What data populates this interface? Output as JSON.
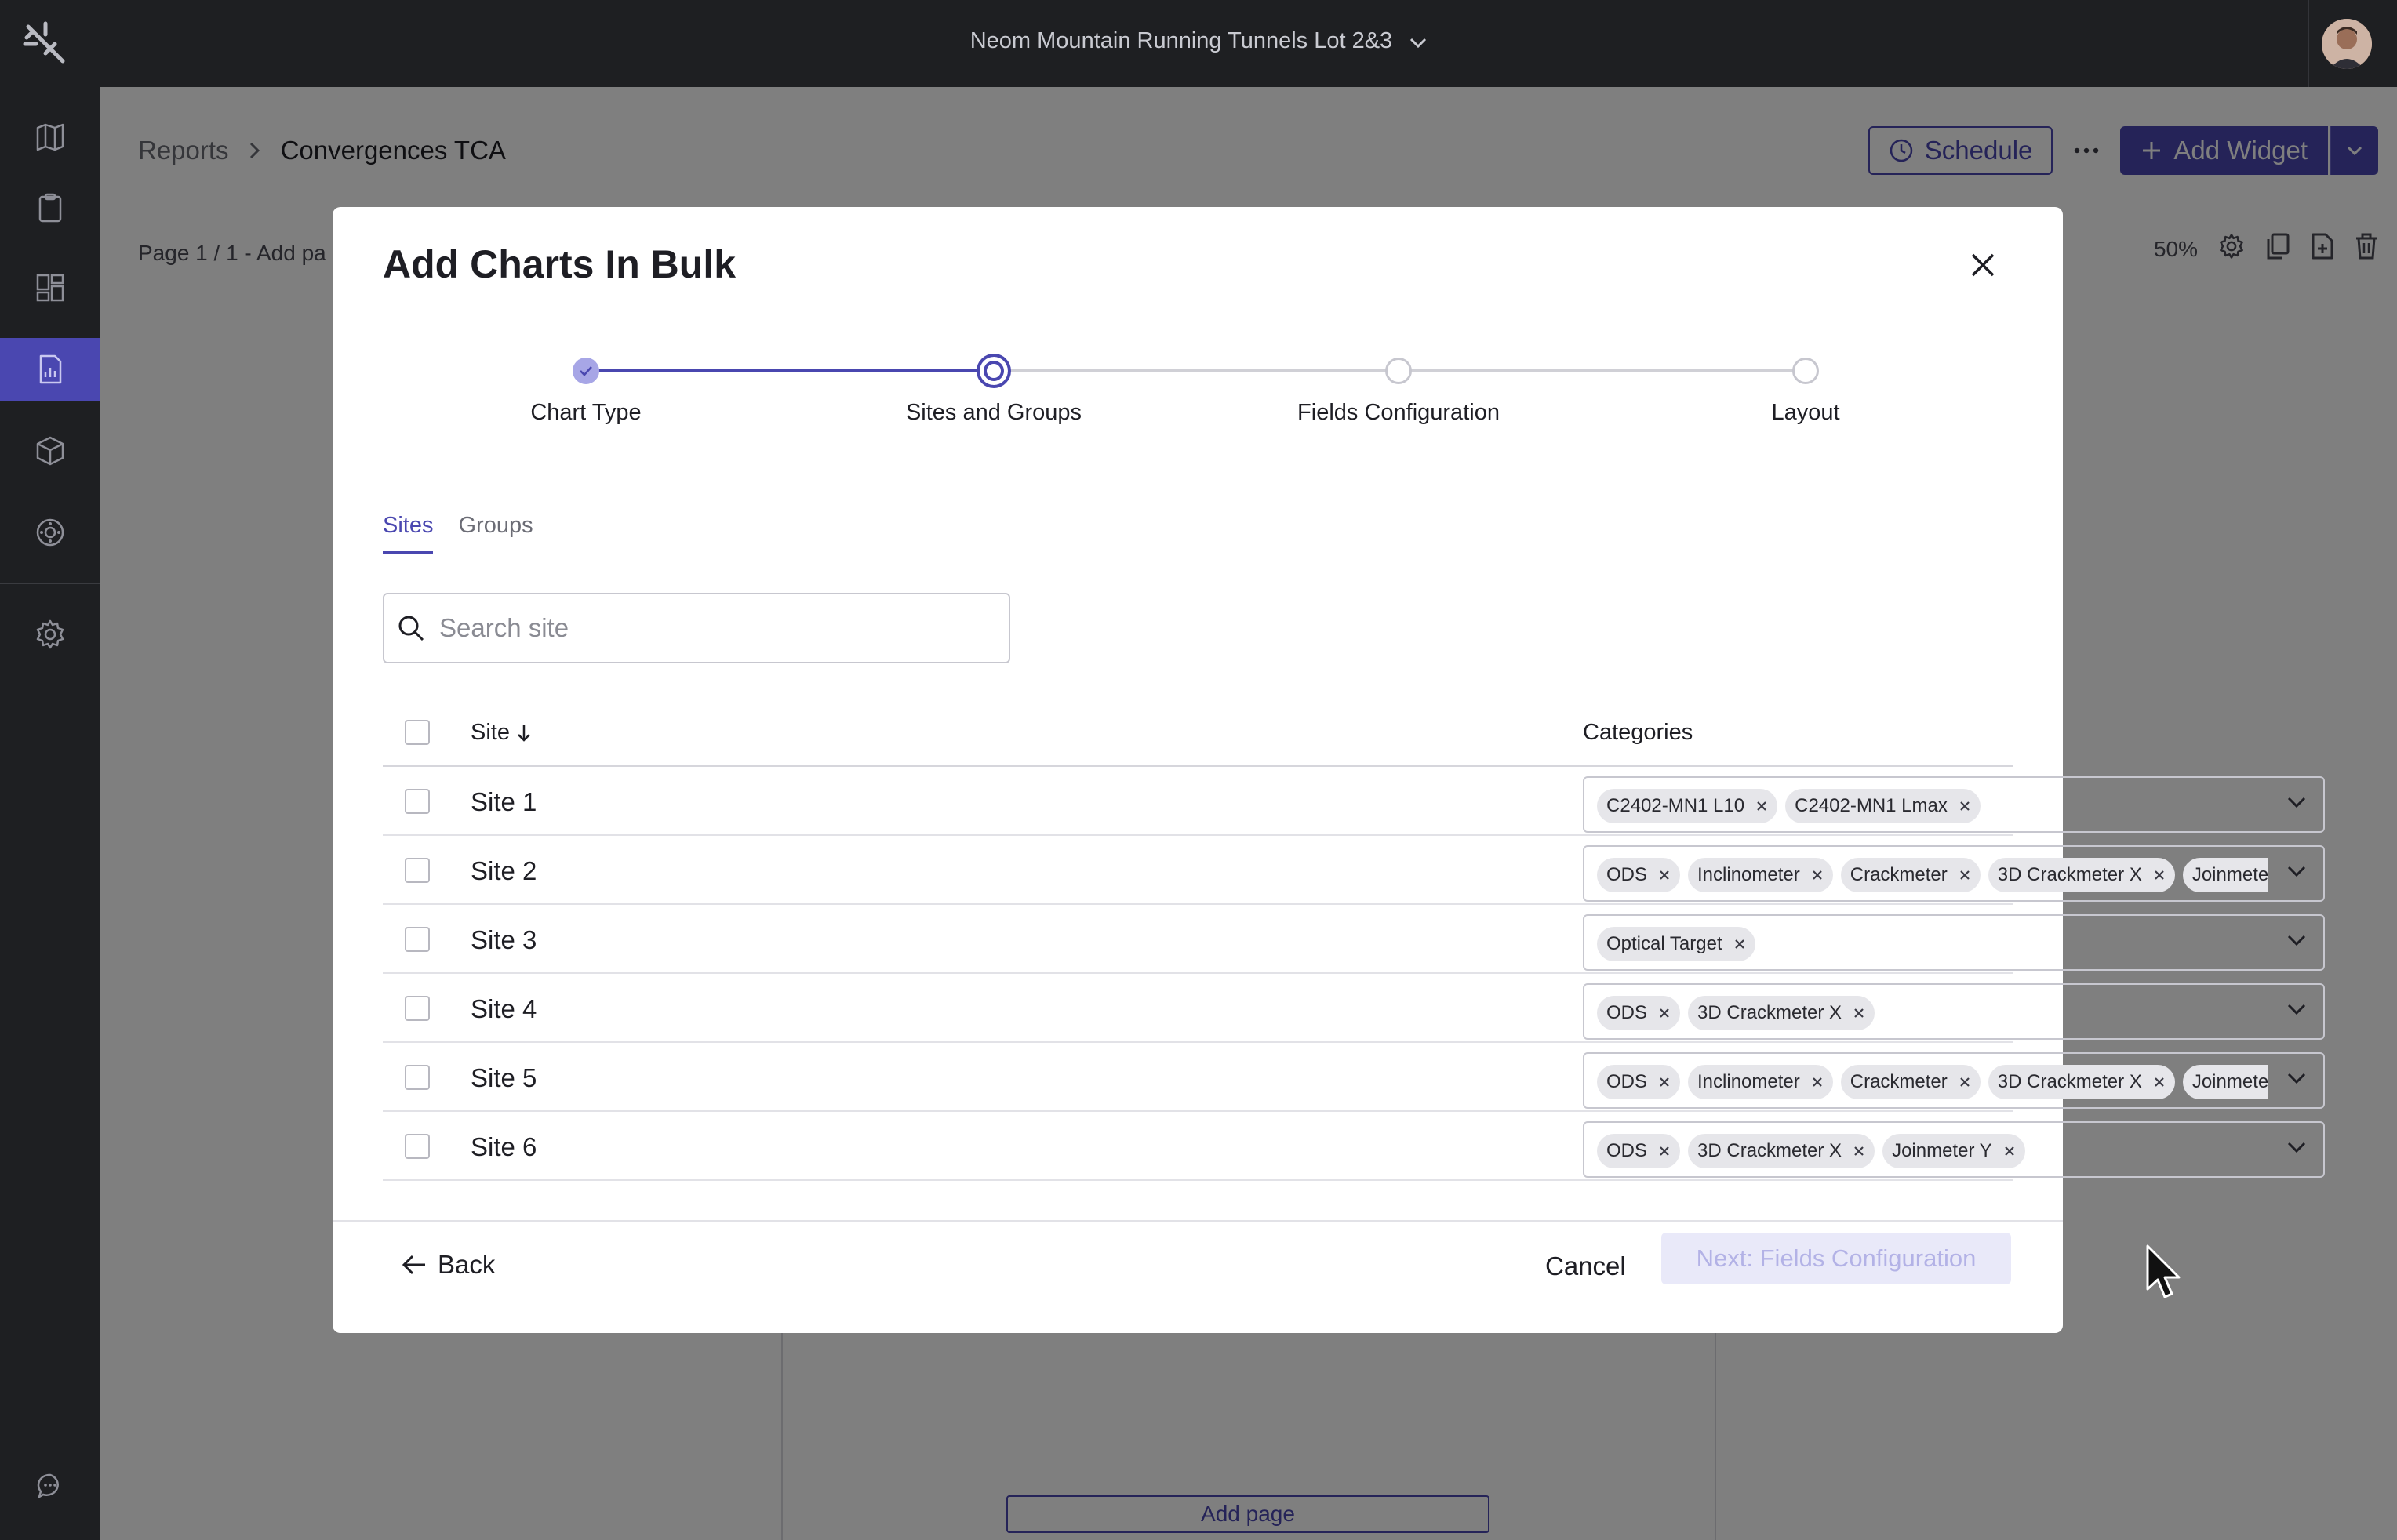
{
  "topbar": {
    "project_name": "Neom Mountain Running Tunnels Lot 2&3"
  },
  "sidebar": {
    "items": [
      {
        "icon": "map-icon"
      },
      {
        "icon": "clipboard-icon"
      },
      {
        "icon": "dashboard-icon"
      },
      {
        "icon": "report-icon",
        "active": true
      },
      {
        "icon": "cube-icon"
      },
      {
        "icon": "target-icon"
      },
      {
        "icon": "gear-icon"
      },
      {
        "icon": "chat-icon"
      }
    ]
  },
  "page": {
    "breadcrumb": [
      "Reports",
      "Convergences TCA"
    ],
    "schedule_label": "Schedule",
    "add_widget_label": "Add Widget",
    "page_info": "Page 1 / 1 - Add pa",
    "zoom": "50%",
    "add_page_label": "Add page"
  },
  "modal": {
    "title": "Add Charts In Bulk",
    "steps": [
      {
        "label": "Chart Type",
        "state": "done"
      },
      {
        "label": "Sites and Groups",
        "state": "current"
      },
      {
        "label": "Fields Configuration",
        "state": "pending"
      },
      {
        "label": "Layout",
        "state": "pending"
      }
    ],
    "tabs": [
      {
        "label": "Sites",
        "active": true
      },
      {
        "label": "Groups",
        "active": false
      }
    ],
    "search_placeholder": "Search site",
    "table": {
      "col_site": "Site",
      "col_categories": "Categories",
      "rows": [
        {
          "site": "Site 1",
          "categories": [
            "C2402-MN1 L10",
            "C2402-MN1 Lmax"
          ]
        },
        {
          "site": "Site 2",
          "categories": [
            "ODS",
            "Inclinometer",
            "Crackmeter",
            "3D Crackmeter X",
            "Joinmeter Y"
          ]
        },
        {
          "site": "Site 3",
          "categories": [
            "Optical Target"
          ]
        },
        {
          "site": "Site 4",
          "categories": [
            "ODS",
            "3D Crackmeter X"
          ]
        },
        {
          "site": "Site 5",
          "categories": [
            "ODS",
            "Inclinometer",
            "Crackmeter",
            "3D Crackmeter X",
            "Joinmeter Y"
          ]
        },
        {
          "site": "Site 6",
          "categories": [
            "ODS",
            "3D Crackmeter X",
            "Joinmeter Y"
          ]
        }
      ]
    },
    "back_label": "Back",
    "cancel_label": "Cancel",
    "next_label": "Next: Fields Configuration"
  },
  "colors": {
    "accent": "#4a47b0",
    "topbar_bg": "#1e1f22",
    "chip_bg": "#e6e6ea"
  }
}
